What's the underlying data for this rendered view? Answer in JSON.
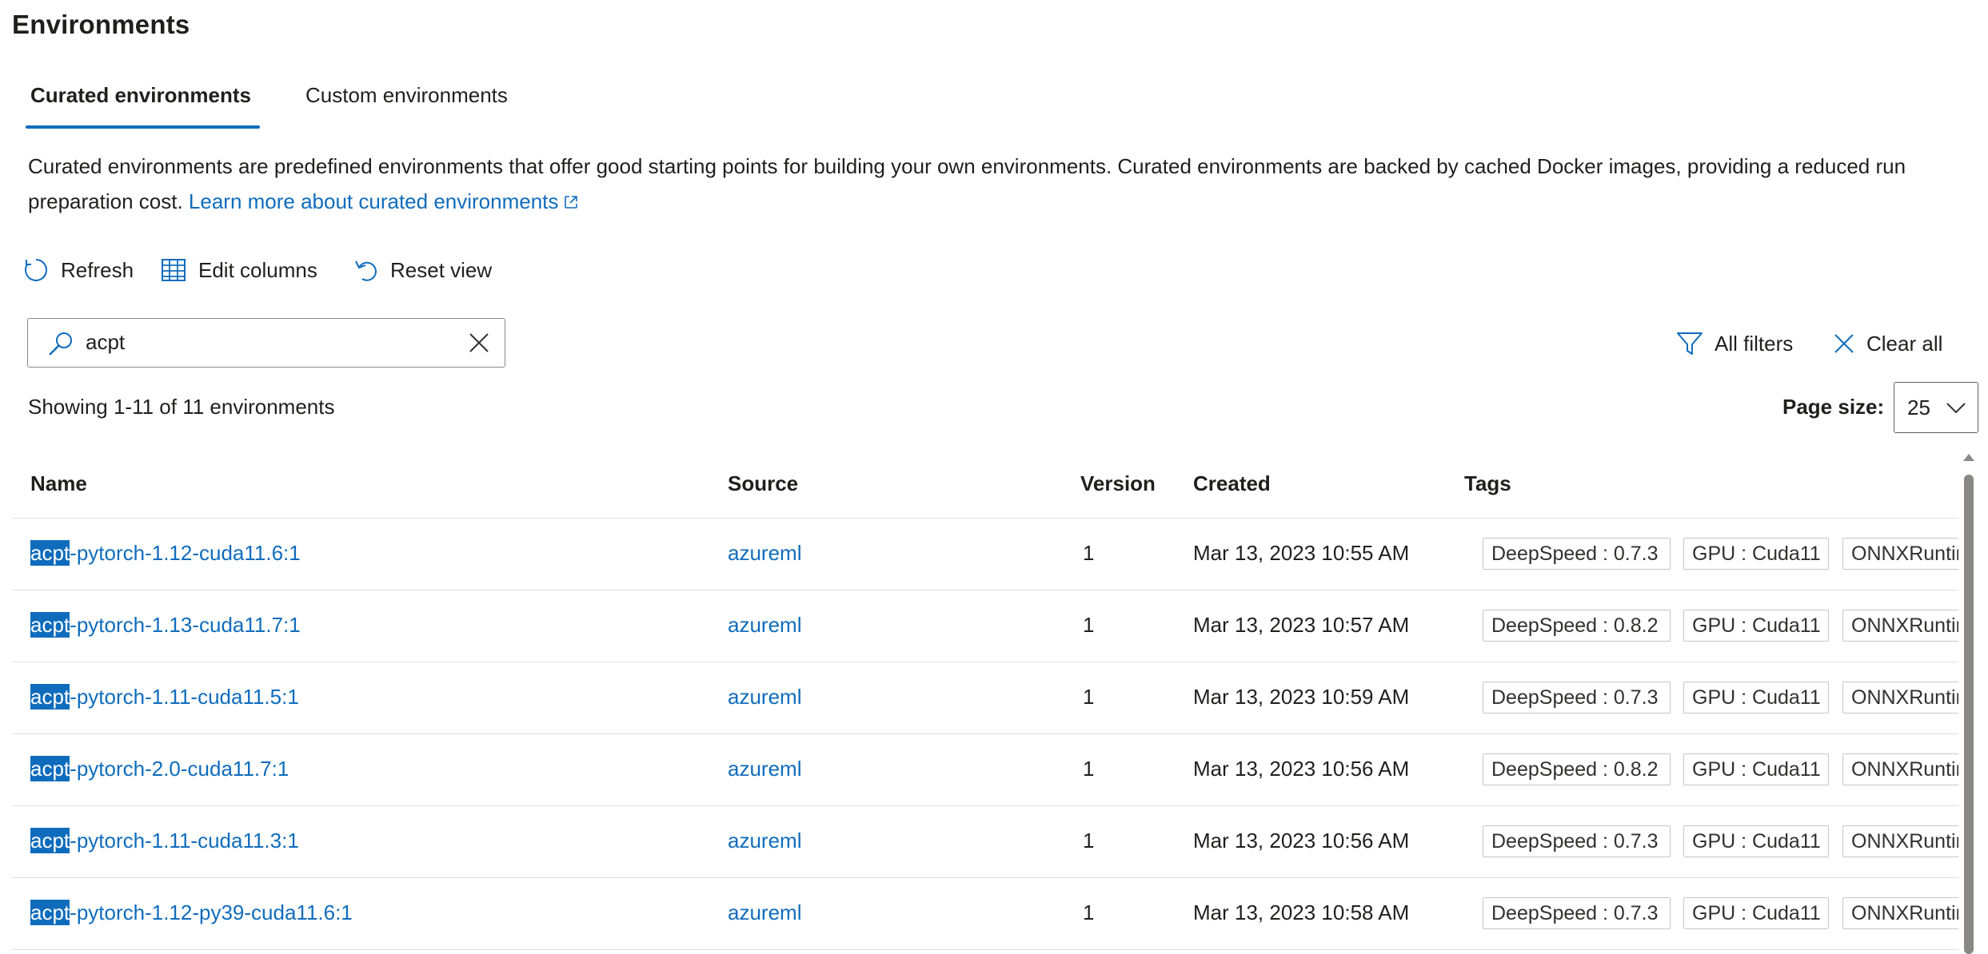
{
  "page": {
    "title": "Environments"
  },
  "tabs": [
    {
      "label": "Curated environments",
      "selected": true
    },
    {
      "label": "Custom environments",
      "selected": false
    }
  ],
  "description": {
    "text": "Curated environments are predefined environments that offer good starting points for building your own environments. Curated environments are backed by cached Docker images, providing a reduced run preparation cost.",
    "link_label": "Learn more about curated environments"
  },
  "toolbar": {
    "refresh_label": "Refresh",
    "edit_columns_label": "Edit columns",
    "reset_view_label": "Reset view"
  },
  "search": {
    "value": "acpt",
    "placeholder": ""
  },
  "filters": {
    "all_filters_label": "All filters",
    "clear_all_label": "Clear all"
  },
  "results": {
    "showing_text": "Showing 1-11 of 11 environments"
  },
  "page_size": {
    "label": "Page size:",
    "value": "25"
  },
  "table": {
    "columns": [
      "Name",
      "Source",
      "Version",
      "Created",
      "Tags"
    ],
    "rows": [
      {
        "name_match": "acpt",
        "name_rest": "-pytorch-1.12-cuda11.6:1",
        "source": "azureml",
        "version": "1",
        "created": "Mar 13, 2023 10:55 AM",
        "tags": [
          "DeepSpeed : 0.7.3",
          "GPU : Cuda11",
          "ONNXRuntime"
        ]
      },
      {
        "name_match": "acpt",
        "name_rest": "-pytorch-1.13-cuda11.7:1",
        "source": "azureml",
        "version": "1",
        "created": "Mar 13, 2023 10:57 AM",
        "tags": [
          "DeepSpeed : 0.8.2",
          "GPU : Cuda11",
          "ONNXRuntime"
        ]
      },
      {
        "name_match": "acpt",
        "name_rest": "-pytorch-1.11-cuda11.5:1",
        "source": "azureml",
        "version": "1",
        "created": "Mar 13, 2023 10:59 AM",
        "tags": [
          "DeepSpeed : 0.7.3",
          "GPU : Cuda11",
          "ONNXRuntime"
        ]
      },
      {
        "name_match": "acpt",
        "name_rest": "-pytorch-2.0-cuda11.7:1",
        "source": "azureml",
        "version": "1",
        "created": "Mar 13, 2023 10:56 AM",
        "tags": [
          "DeepSpeed : 0.8.2",
          "GPU : Cuda11",
          "ONNXRuntime"
        ]
      },
      {
        "name_match": "acpt",
        "name_rest": "-pytorch-1.11-cuda11.3:1",
        "source": "azureml",
        "version": "1",
        "created": "Mar 13, 2023 10:56 AM",
        "tags": [
          "DeepSpeed : 0.7.3",
          "GPU : Cuda11",
          "ONNXRuntime"
        ]
      },
      {
        "name_match": "acpt",
        "name_rest": "-pytorch-1.12-py39-cuda11.6:1",
        "source": "azureml",
        "version": "1",
        "created": "Mar 13, 2023 10:58 AM",
        "tags": [
          "DeepSpeed : 0.7.3",
          "GPU : Cuda11",
          "ONNXRuntime"
        ]
      }
    ]
  },
  "colors": {
    "accent": "#0f6cbd",
    "text": "#201f1e",
    "border": "#e1dfdd",
    "tag_border": "#c8c6c4"
  },
  "icons": [
    "refresh-icon",
    "edit-columns-icon",
    "reset-view-icon",
    "search-icon",
    "clear-search-icon",
    "filter-icon",
    "close-icon",
    "chevron-down-icon",
    "external-link-icon"
  ]
}
